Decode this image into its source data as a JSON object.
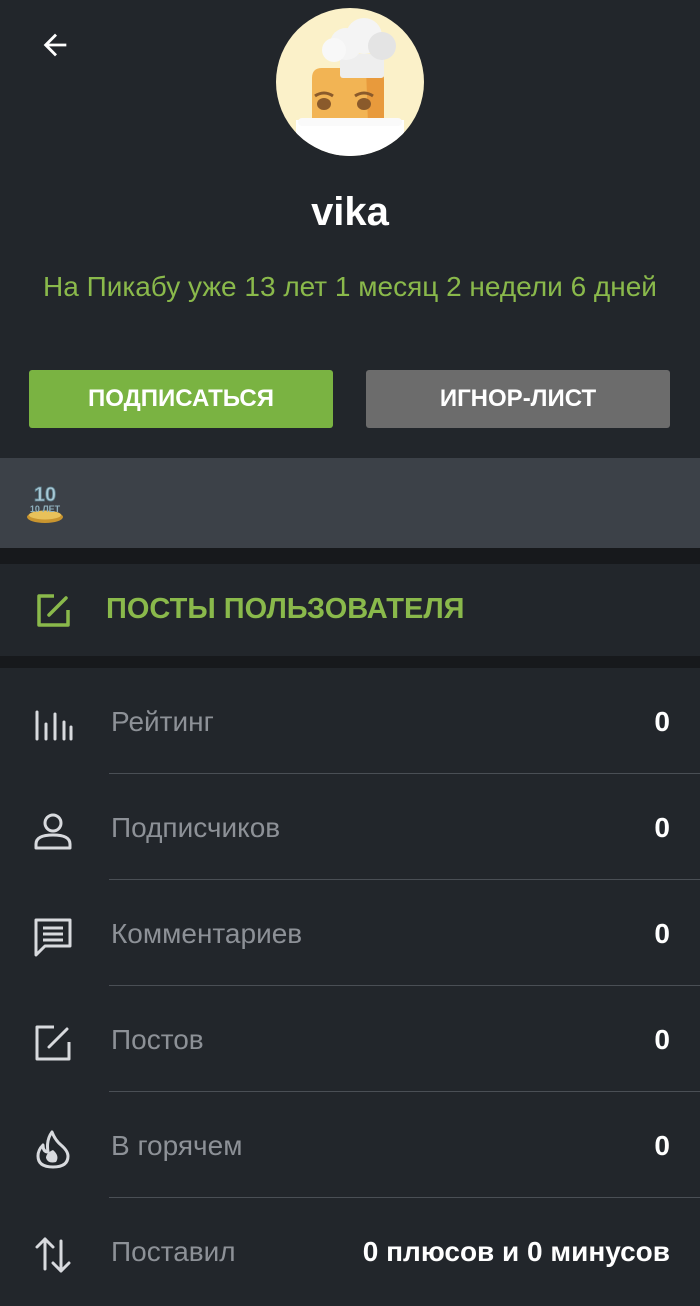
{
  "header": {
    "back_icon": "arrow-left-icon"
  },
  "profile": {
    "avatar_icon": "chef-avatar",
    "username": "vika",
    "since_text": "На Пикабу уже 13 лет 1 месяц 2 недели 6 дней"
  },
  "actions": {
    "subscribe_label": "ПОДПИСАТЬСЯ",
    "ignore_label": "ИГНОР-ЛИСТ"
  },
  "awards": [
    {
      "icon": "10-years-award-icon",
      "text": "10 ЛЕТ"
    }
  ],
  "posts_link": {
    "icon": "edit-icon",
    "label": "ПОСТЫ ПОЛЬЗОВАТЕЛЯ"
  },
  "stats": [
    {
      "icon": "bar-chart-icon",
      "label": "Рейтинг",
      "value": "0"
    },
    {
      "icon": "person-icon",
      "label": "Подписчиков",
      "value": "0"
    },
    {
      "icon": "comment-icon",
      "label": "Комментариев",
      "value": "0"
    },
    {
      "icon": "edit-icon",
      "label": "Постов",
      "value": "0"
    },
    {
      "icon": "fire-icon",
      "label": "В горячем",
      "value": "0"
    },
    {
      "icon": "sort-arrows-icon",
      "label": "Поставил",
      "value": "0 плюсов и 0 минусов"
    }
  ],
  "colors": {
    "background": "#22262b",
    "accent_green": "#8ab94b",
    "subscribe_button": "#7ab342",
    "ignore_button": "#6c6c6c",
    "awards_bar": "#3c4148"
  }
}
